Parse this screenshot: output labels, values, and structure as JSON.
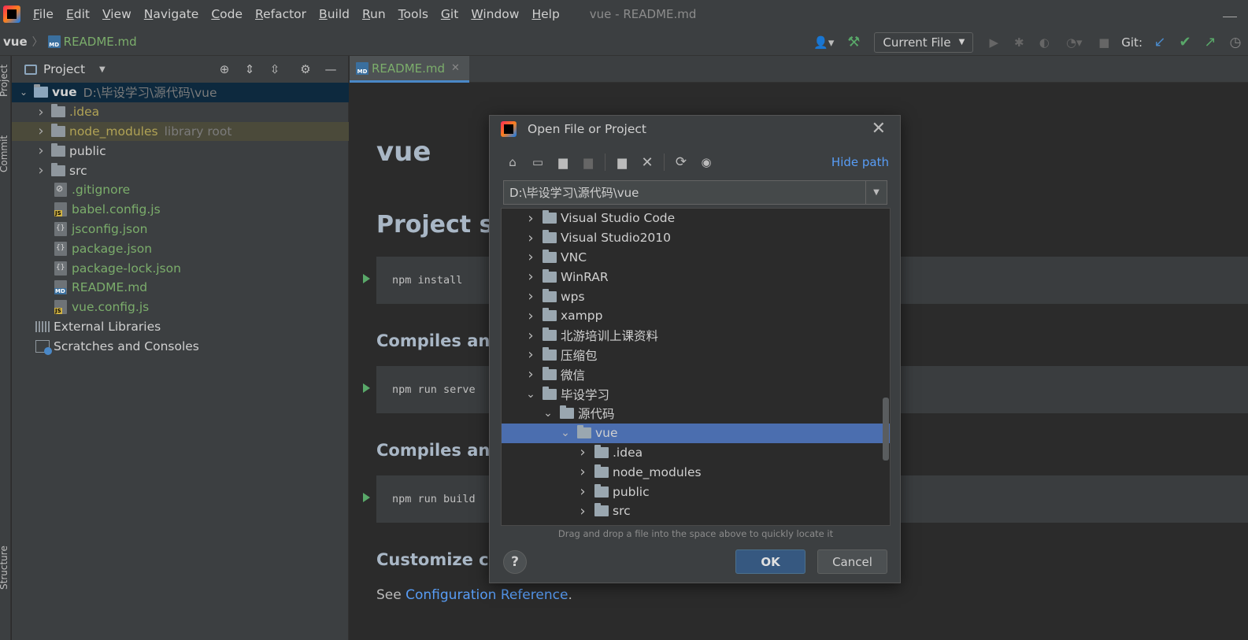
{
  "menu": {
    "items": [
      {
        "mnemonic": "F",
        "rest": "ile"
      },
      {
        "mnemonic": "E",
        "rest": "dit"
      },
      {
        "mnemonic": "V",
        "rest": "iew"
      },
      {
        "mnemonic": "N",
        "rest": "avigate"
      },
      {
        "mnemonic": "C",
        "rest": "ode"
      },
      {
        "mnemonic": "R",
        "rest": "efactor"
      },
      {
        "mnemonic": "B",
        "rest": "uild"
      },
      {
        "mnemonic": "R",
        "rest": "un"
      },
      {
        "mnemonic": "T",
        "rest": "ools"
      },
      {
        "mnemonic": "G",
        "rest": "it"
      },
      {
        "mnemonic": "W",
        "rest": "indow"
      },
      {
        "mnemonic": "H",
        "rest": "elp"
      }
    ],
    "window_title": "vue - README.md"
  },
  "navbar": {
    "root": "vue",
    "file": "README.md",
    "run_config": "Current File",
    "git_label": "Git:"
  },
  "left_stripe": {
    "project": "Project",
    "commit": "Commit",
    "structure": "Structure"
  },
  "project_panel": {
    "title": "Project",
    "root_name": "vue",
    "root_path": "D:\\毕设学习\\源代码\\vue",
    "items": [
      {
        "name": ".idea",
        "kind": "folder",
        "color": "olive"
      },
      {
        "name": "node_modules",
        "kind": "folder",
        "color": "olive",
        "suffix": "library root"
      },
      {
        "name": "public",
        "kind": "folder",
        "color": "white"
      },
      {
        "name": "src",
        "kind": "folder",
        "color": "white"
      },
      {
        "name": ".gitignore",
        "kind": "git",
        "color": "green"
      },
      {
        "name": "babel.config.js",
        "kind": "js",
        "color": "green"
      },
      {
        "name": "jsconfig.json",
        "kind": "json",
        "color": "green"
      },
      {
        "name": "package.json",
        "kind": "json",
        "color": "green"
      },
      {
        "name": "package-lock.json",
        "kind": "json",
        "color": "green"
      },
      {
        "name": "README.md",
        "kind": "md",
        "color": "green"
      },
      {
        "name": "vue.config.js",
        "kind": "js",
        "color": "green"
      }
    ],
    "external_libraries": "External Libraries",
    "scratches": "Scratches and Consoles"
  },
  "editor": {
    "tab_label": "README.md",
    "h1": "vue",
    "h2_setup": "Project se",
    "h3_compiles_1": "Compiles and",
    "h3_compiles_2": "Compiles and",
    "h3_customize": "Customize co",
    "code_install": "npm install",
    "code_serve": "npm run serve",
    "code_build": "npm run build",
    "see_prefix": "See ",
    "see_link": "Configuration Reference",
    "see_suffix": "."
  },
  "dialog": {
    "title": "Open File or Project",
    "hide_path": "Hide path",
    "path_value": "D:\\毕设学习\\源代码\\vue",
    "tree": [
      {
        "name": "Visual Studio Code",
        "level": 0,
        "expanded": false
      },
      {
        "name": "Visual Studio2010",
        "level": 0,
        "expanded": false
      },
      {
        "name": "VNC",
        "level": 0,
        "expanded": false
      },
      {
        "name": "WinRAR",
        "level": 0,
        "expanded": false
      },
      {
        "name": "wps",
        "level": 0,
        "expanded": false
      },
      {
        "name": "xampp",
        "level": 0,
        "expanded": false
      },
      {
        "name": "北游培训上课资料",
        "level": 0,
        "expanded": false
      },
      {
        "name": "压缩包",
        "level": 0,
        "expanded": false
      },
      {
        "name": "微信",
        "level": 0,
        "expanded": false
      },
      {
        "name": "毕设学习",
        "level": 0,
        "expanded": true
      },
      {
        "name": "源代码",
        "level": 1,
        "expanded": true
      },
      {
        "name": "vue",
        "level": 2,
        "expanded": true,
        "selected": true
      },
      {
        "name": ".idea",
        "level": 3,
        "expanded": false
      },
      {
        "name": "node_modules",
        "level": 3,
        "expanded": false
      },
      {
        "name": "public",
        "level": 3,
        "expanded": false
      },
      {
        "name": "src",
        "level": 3,
        "expanded": false
      }
    ],
    "drop_hint": "Drag and drop a file into the space above to quickly locate it",
    "help_label": "?",
    "ok_label": "OK",
    "cancel_label": "Cancel"
  },
  "icons": {
    "toolbar": [
      "user-icon",
      "build-hammer-icon",
      "run-icon",
      "debug-icon",
      "coverage-icon",
      "profile-icon",
      "stop-icon",
      "git-update-icon",
      "git-commit-icon",
      "git-push-icon",
      "history-icon"
    ],
    "project_tools": [
      "locate-icon",
      "expand-all-icon",
      "collapse-all-icon",
      "gear-icon",
      "hide-icon"
    ],
    "dialog_tools": [
      "home-icon",
      "desktop-icon",
      "project-folder-icon",
      "module-folder-icon",
      "new-folder-icon",
      "delete-icon",
      "refresh-icon",
      "show-hidden-icon"
    ]
  },
  "colors": {
    "accent": "#4a88c7",
    "selection": "#4b6eaf",
    "file_green": "#7bad6b",
    "folder_olive": "#b0a255",
    "link": "#589df6",
    "run_green": "#59a869"
  }
}
